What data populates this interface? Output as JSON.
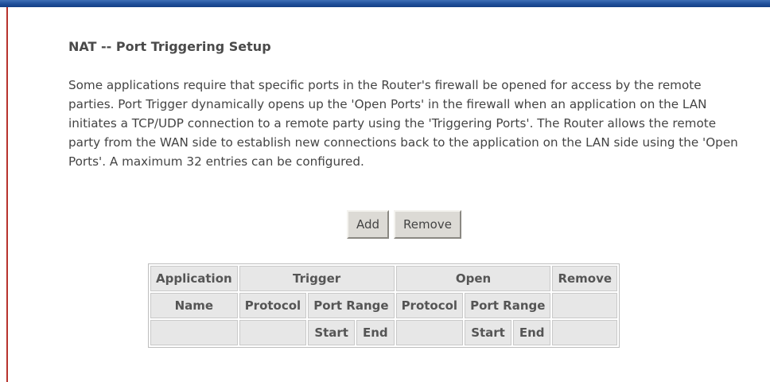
{
  "page": {
    "title": "NAT -- Port Triggering Setup",
    "description": "Some applications require that specific ports in the Router's firewall be opened for access by the remote parties. Port Trigger dynamically opens up the 'Open Ports' in the firewall when an application on the LAN initiates a TCP/UDP connection to a remote party using the 'Triggering Ports'. The Router allows the remote party from the WAN side to establish new connections back to the application on the LAN side using the 'Open Ports'. A maximum 32 entries can be configured."
  },
  "buttons": {
    "add": "Add",
    "remove": "Remove"
  },
  "table": {
    "row1": {
      "application": "Application",
      "trigger": "Trigger",
      "open": "Open",
      "remove": "Remove"
    },
    "row2": {
      "name": "Name",
      "trigger_protocol": "Protocol",
      "trigger_port_range": "Port Range",
      "open_protocol": "Protocol",
      "open_port_range": "Port Range"
    },
    "row3": {
      "trigger_start": "Start",
      "trigger_end": "End",
      "open_start": "Start",
      "open_end": "End"
    }
  },
  "colors": {
    "top_bar": "#1f4f9a",
    "left_line": "#b7332d",
    "header_cell": "#e7e7e7"
  }
}
